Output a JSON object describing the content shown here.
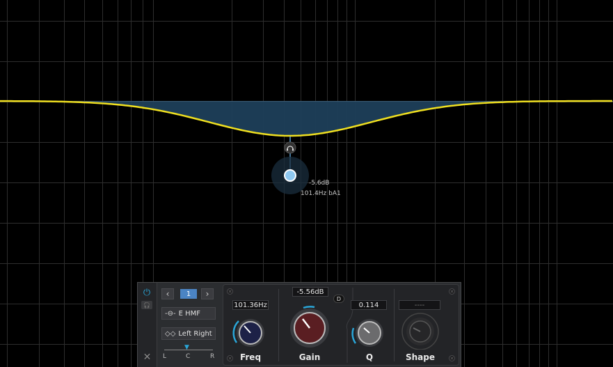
{
  "graph": {
    "point_gain_readout": "-5.6dB",
    "point_freq_readout": "101.4Hz bA1",
    "colors": {
      "curve": "#f0e020",
      "fill": "#1e3f5a",
      "grid": "#2e2e2e",
      "point": "#8ec8f0",
      "accent": "#2aa6d8"
    }
  },
  "panel": {
    "band_number": "1",
    "prev_icon": "chevron-left-icon",
    "next_icon": "chevron-right-icon",
    "filter_type": "E HMF",
    "channel_mode": "Left Right",
    "pan": {
      "left": "L",
      "center": "C",
      "right": "R"
    },
    "freq": {
      "value": "101.36Hz",
      "label": "Freq"
    },
    "gain": {
      "value": "-5.56dB",
      "label": "Gain"
    },
    "q": {
      "value": "0.114",
      "label": "Q"
    },
    "shape": {
      "value": "----",
      "label": "Shape"
    },
    "dynamic_label": "D"
  }
}
